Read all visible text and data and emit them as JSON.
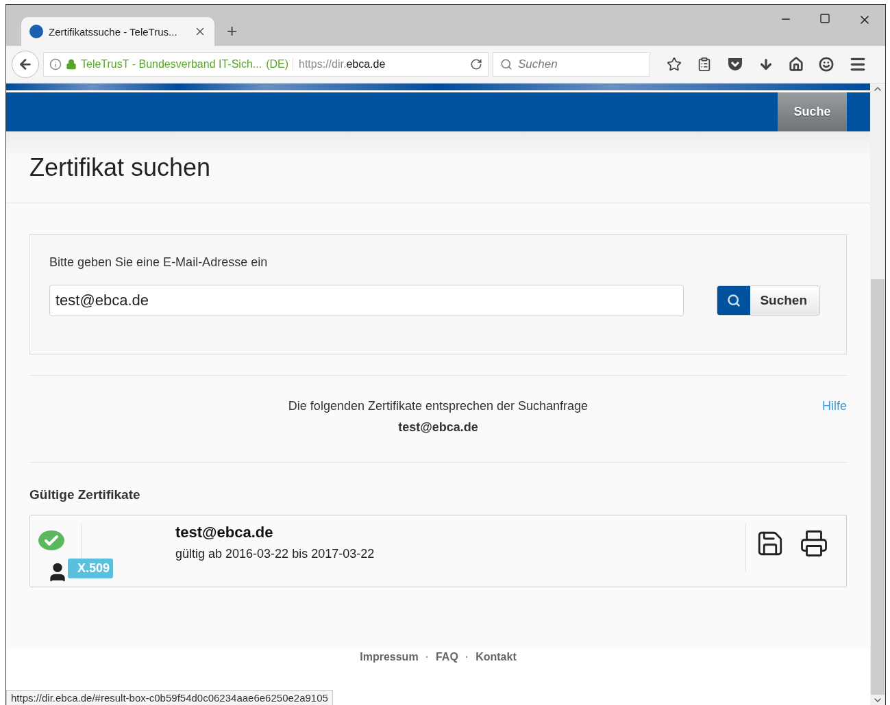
{
  "browser": {
    "tab": {
      "title": "Zertifikatssuche - TeleTrus...",
      "selected": true
    },
    "new_tab": "+",
    "site_identity": "TeleTrusT - Bundesverband IT-Sich...",
    "site_country": "(DE)",
    "url_prefix": "https://dir.",
    "url_domain": "ebca.de",
    "search_placeholder": "Suchen"
  },
  "nav": {
    "button": "Suche"
  },
  "page_title": "Zertifikat suchen",
  "search": {
    "label": "Bitte geben Sie eine E-Mail-Adresse ein",
    "value": "test@ebca.de",
    "button": "Suchen"
  },
  "results": {
    "intro": "Die folgenden Zertifikate entsprechen der Suchanfrage",
    "query": "test@ebca.de",
    "help_link": "Hilfe"
  },
  "valid_section": {
    "heading": "Gültige Zertifikate",
    "certificates": [
      {
        "email": "test@ebca.de",
        "validity": "gültig ab 2016-03-22 bis 2017-03-22",
        "type": "X.509",
        "valid": true
      }
    ]
  },
  "footer": [
    {
      "kind": "link",
      "text": "Impressum"
    },
    {
      "kind": "separator",
      "text": "·"
    },
    {
      "kind": "link",
      "text": "FAQ"
    },
    {
      "kind": "separator",
      "text": "·"
    },
    {
      "kind": "link",
      "text": "Kontakt"
    }
  ],
  "status_url": "https://dir.ebca.de/#result-box-c0b59f54d0c06234aae6e6250e2a9105"
}
